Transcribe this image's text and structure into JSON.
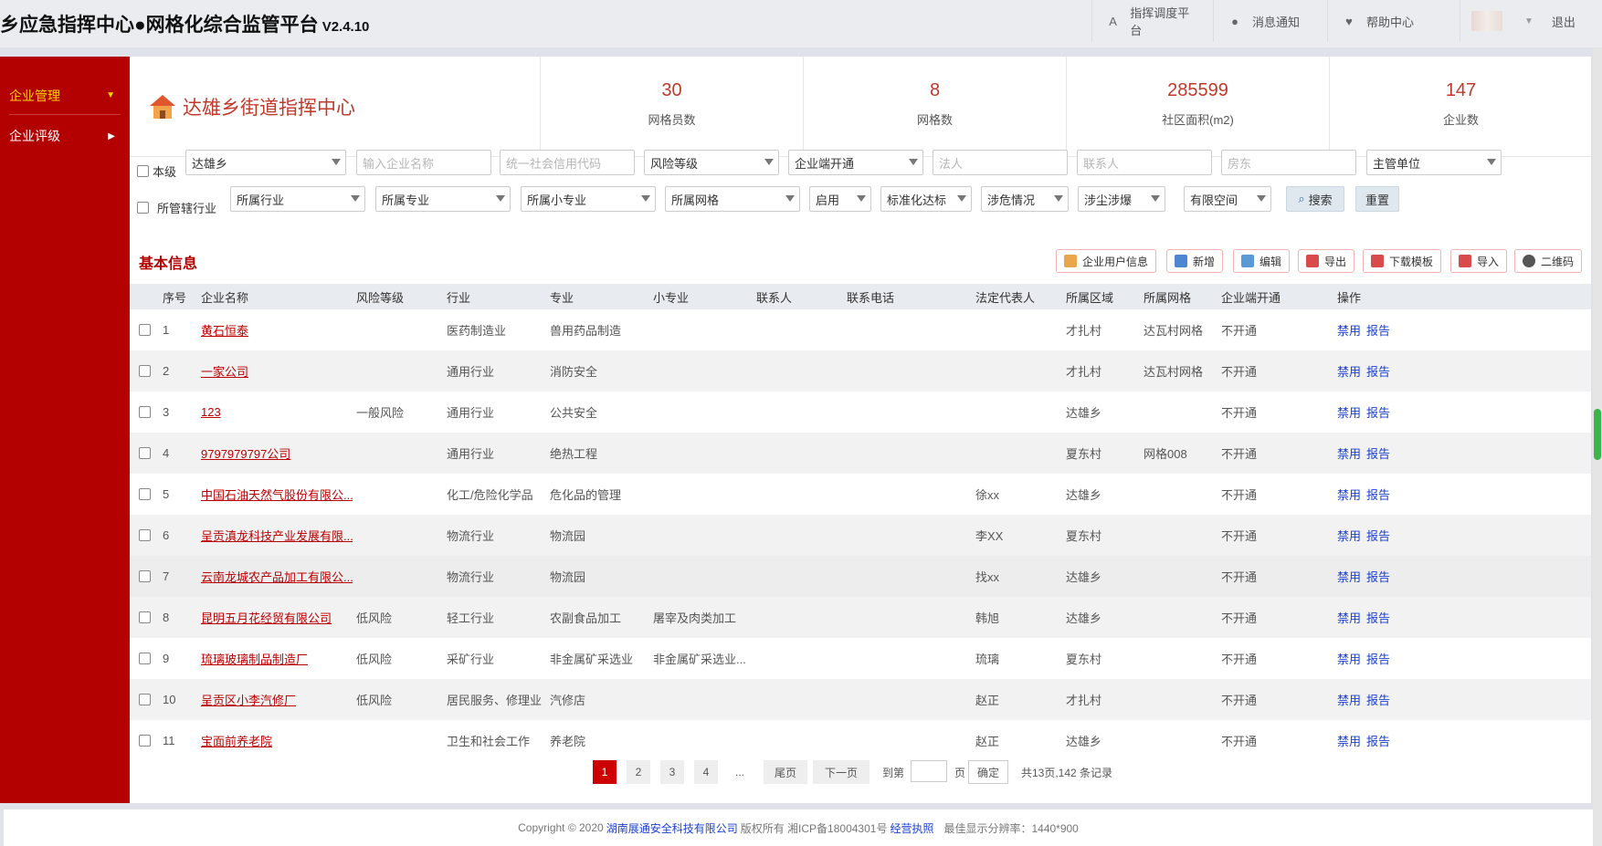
{
  "header": {
    "title": "乡应急指挥中心●网格化综合监管平台",
    "version": "V2.4.10",
    "nav": [
      {
        "label": "指挥调度平台",
        "icon": "dispatch-icon"
      },
      {
        "label": "消息通知",
        "icon": "message-icon"
      },
      {
        "label": "帮助中心",
        "icon": "heart-icon"
      }
    ],
    "logout": "退出"
  },
  "sidebar": {
    "items": [
      {
        "label": "企业管理",
        "arrow": "▼"
      },
      {
        "label": "企业评级",
        "arrow": "▶"
      }
    ]
  },
  "stats": {
    "center_name": "达雄乡街道指挥中心",
    "items": [
      {
        "value": "30",
        "label": "网格员数"
      },
      {
        "value": "8",
        "label": "网格数"
      },
      {
        "value": "285599",
        "label": "社区面积(m2)"
      },
      {
        "value": "147",
        "label": "企业数"
      }
    ]
  },
  "filters": {
    "this_level": "本级",
    "township": "达雄乡",
    "company_name_ph": "输入企业名称",
    "credit_code_ph": "统一社会信用代码",
    "risk_level": "风险等级",
    "enterprise_access": "企业端开通",
    "legal_person_ph": "法人",
    "contact_ph": "联系人",
    "landlord_ph": "房东",
    "supervisor": "主管单位",
    "industry_label": "所管辖行业",
    "industry": "所属行业",
    "major": "所属专业",
    "minor_major": "所属小专业",
    "grid": "所属网格",
    "enabled": "启用",
    "standard": "标准化达标",
    "hazard": "涉危情况",
    "dust": "涉尘涉爆",
    "confined": "有限空间",
    "search": "搜索",
    "reset": "重置"
  },
  "section": {
    "title": "基本信息",
    "actions": [
      "企业用户信息",
      "新增",
      "编辑",
      "导出",
      "下载模板",
      "导入",
      "二维码"
    ]
  },
  "table": {
    "headers": [
      "序号",
      "企业名称",
      "风险等级",
      "行业",
      "专业",
      "小专业",
      "联系人",
      "联系电话",
      "法定代表人",
      "所属区域",
      "所属网格",
      "企业端开通",
      "操作"
    ],
    "rows": [
      {
        "no": "1",
        "name": "黄石恒泰",
        "risk": "",
        "industry": "医药制造业",
        "major": "兽用药品制造",
        "minor": "",
        "contact": "",
        "phone": "",
        "legal": "",
        "area": "才扎村",
        "grid": "达瓦村网格",
        "access": "不开通"
      },
      {
        "no": "2",
        "name": "一家公司",
        "risk": "",
        "industry": "通用行业",
        "major": "消防安全",
        "minor": "",
        "contact": "",
        "phone": "",
        "legal": "",
        "area": "才扎村",
        "grid": "达瓦村网格",
        "access": "不开通"
      },
      {
        "no": "3",
        "name": "123",
        "risk": "一般风险",
        "industry": "通用行业",
        "major": "公共安全",
        "minor": "",
        "contact": "",
        "phone": "",
        "legal": "",
        "area": "达雄乡",
        "grid": "",
        "access": "不开通"
      },
      {
        "no": "4",
        "name": "9797979797公司",
        "risk": "",
        "industry": "通用行业",
        "major": "绝热工程",
        "minor": "",
        "contact": "",
        "phone": "",
        "legal": "",
        "area": "夏东村",
        "grid": "网格008",
        "access": "不开通"
      },
      {
        "no": "5",
        "name": "中国石油天然气股份有限公...",
        "risk": "",
        "industry": "化工/危险化学品",
        "major": "危化品的管理",
        "minor": "",
        "contact": "",
        "phone": "",
        "legal": "徐xx",
        "area": "达雄乡",
        "grid": "",
        "access": "不开通"
      },
      {
        "no": "6",
        "name": "呈贡滇龙科技产业发展有限...",
        "risk": "",
        "industry": "物流行业",
        "major": "物流园",
        "minor": "",
        "contact": "",
        "phone": "",
        "legal": "李XX",
        "area": "夏东村",
        "grid": "",
        "access": "不开通"
      },
      {
        "no": "7",
        "name": "云南龙城农产品加工有限公...",
        "risk": "",
        "industry": "物流行业",
        "major": "物流园",
        "minor": "",
        "contact": "",
        "phone": "",
        "legal": "找xx",
        "area": "达雄乡",
        "grid": "",
        "access": "不开通"
      },
      {
        "no": "8",
        "name": "昆明五月花经贸有限公司",
        "risk": "低风险",
        "industry": "轻工行业",
        "major": "农副食品加工",
        "minor": "屠宰及肉类加工",
        "contact": "",
        "phone": "",
        "legal": "韩旭",
        "area": "达雄乡",
        "grid": "",
        "access": "不开通"
      },
      {
        "no": "9",
        "name": "琉璃玻璃制品制造厂",
        "risk": "低风险",
        "industry": "采矿行业",
        "major": "非金属矿采选业",
        "minor": "非金属矿采选业...",
        "contact": "",
        "phone": "",
        "legal": "琉璃",
        "area": "夏东村",
        "grid": "",
        "access": "不开通"
      },
      {
        "no": "10",
        "name": "呈贡区小李汽修厂",
        "risk": "低风险",
        "industry": "居民服务、修理业",
        "major": "汽修店",
        "minor": "",
        "contact": "",
        "phone": "",
        "legal": "赵正",
        "area": "才扎村",
        "grid": "",
        "access": "不开通"
      },
      {
        "no": "11",
        "name": "宝面前养老院",
        "risk": "",
        "industry": "卫生和社会工作",
        "major": "养老院",
        "minor": "",
        "contact": "",
        "phone": "",
        "legal": "赵正",
        "area": "达雄乡",
        "grid": "",
        "access": "不开通"
      }
    ],
    "op_disable": "禁用",
    "op_report": "报告"
  },
  "pager": {
    "pages": [
      "1",
      "2",
      "3",
      "4"
    ],
    "ellipsis": "...",
    "last": "尾页",
    "next": "下一页",
    "goto": "到第",
    "page_unit": "页",
    "confirm": "确定",
    "summary": "共13页,142 条记录"
  },
  "footer": {
    "copyright": "Copyright © 2020",
    "company": "湖南展通安全科技有限公司",
    "rights": "版权所有 湘ICP备18004301号",
    "license": "经营执照",
    "resolution": "最佳显示分辨率：1440*900"
  },
  "colors": {
    "brand_red": "#b30000",
    "accent_yellow": "#ffd200",
    "link_blue": "#1a3fd4"
  }
}
